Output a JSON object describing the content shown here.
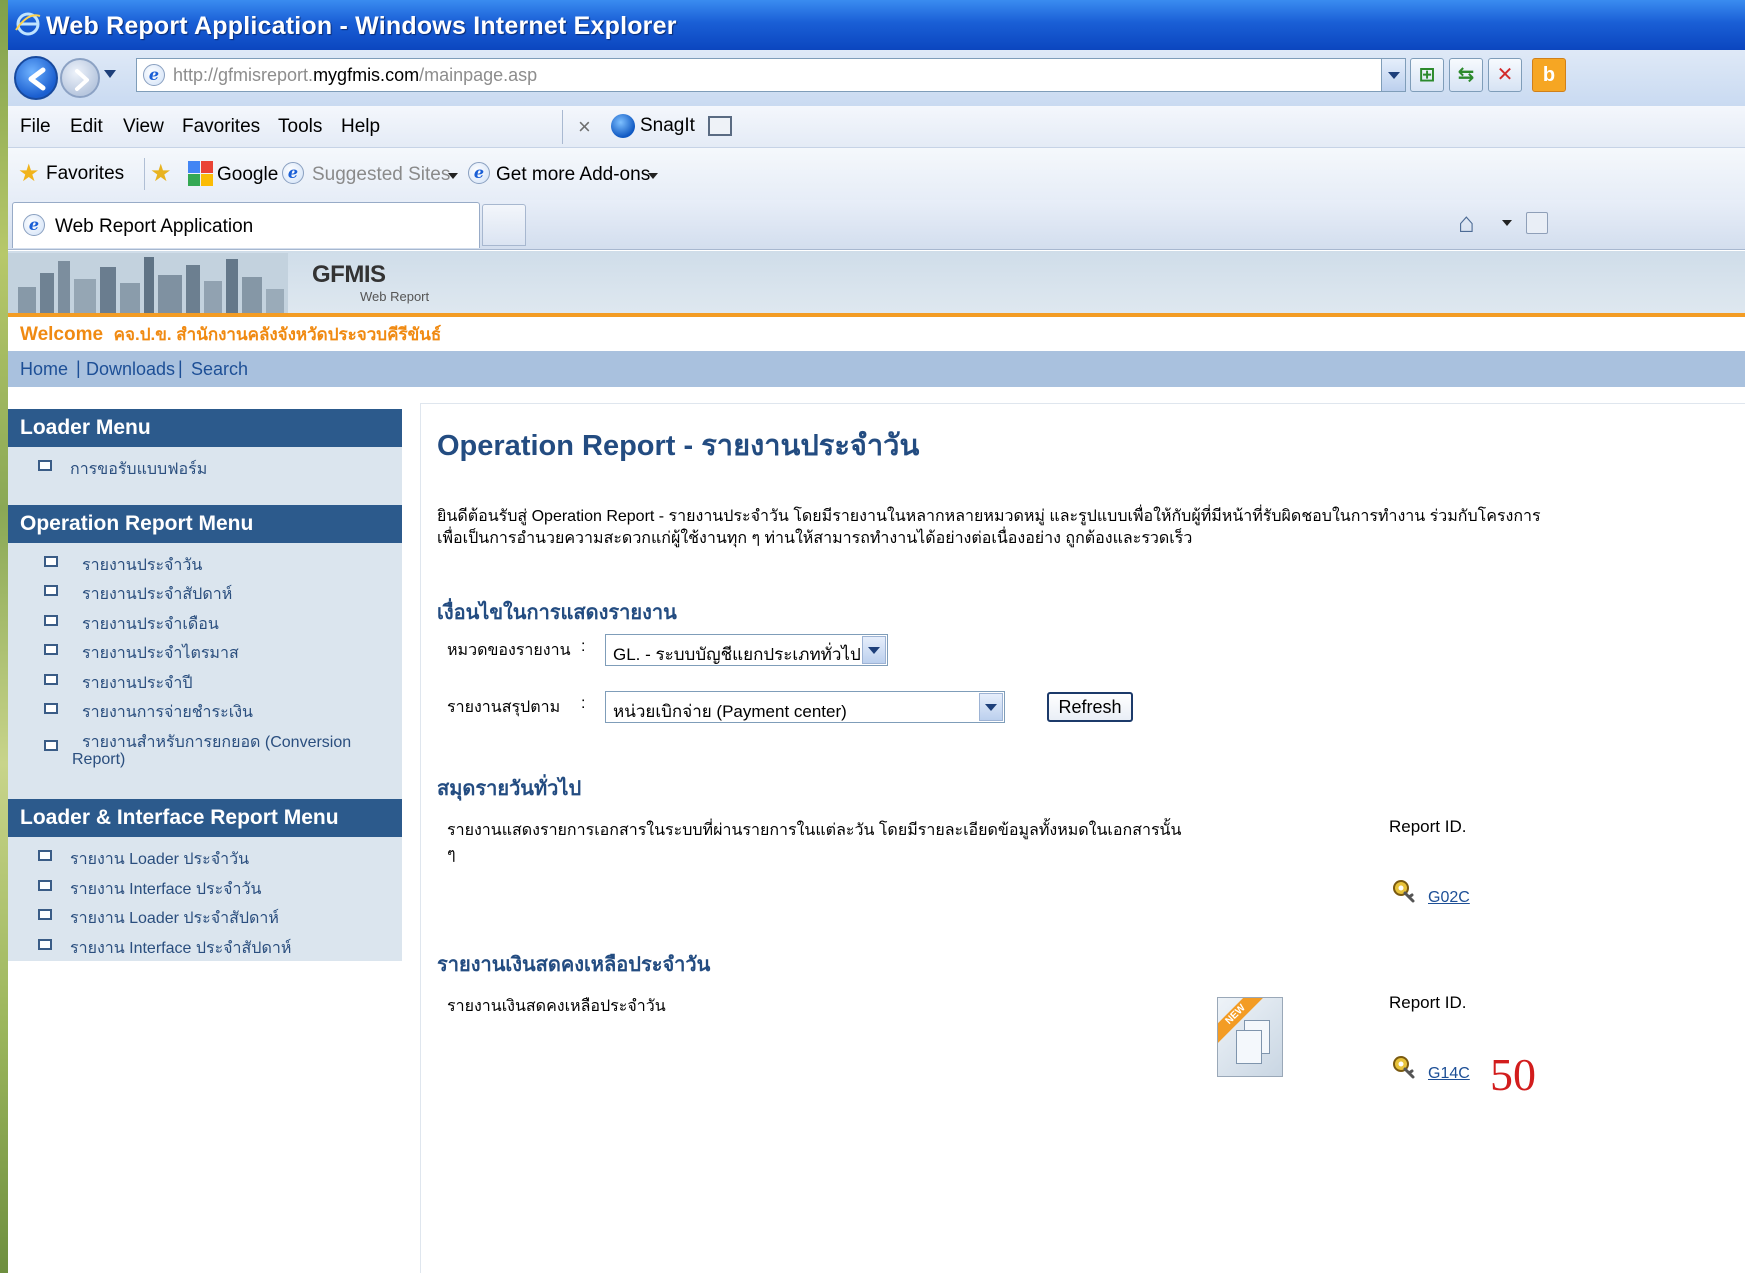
{
  "window": {
    "title": "Web Report Application - Windows Internet Explorer"
  },
  "address": {
    "url_prefix": "http://gfmisreport.",
    "url_domain": "mygfmis.com",
    "url_path": "/mainpage.asp"
  },
  "menu": {
    "items": [
      "File",
      "Edit",
      "View",
      "Favorites",
      "Tools",
      "Help"
    ],
    "snagit": "SnagIt"
  },
  "favorites_bar": {
    "favorites_label": "Favorites",
    "google_label": "Google",
    "suggested_label": "Suggested Sites",
    "addons_label": "Get more Add-ons"
  },
  "tabs": {
    "active_label": "Web Report Application"
  },
  "banner": {
    "brand": "GFMIS",
    "sub": "Web Report"
  },
  "welcome": {
    "label": "Welcome",
    "user": "คจ.ป.ข. สำนักงานคลังจังหวัดประจวบคีรีขันธ์"
  },
  "topnav": {
    "items": [
      "Home",
      "Downloads",
      "Search"
    ]
  },
  "sidebar": {
    "loader_menu": {
      "title": "Loader Menu",
      "items": [
        "การขอรับแบบฟอร์ม"
      ]
    },
    "operation_menu": {
      "title": "Operation Report Menu",
      "items": [
        "รายงานประจำวัน",
        "รายงานประจำสัปดาห์",
        "รายงานประจำเดือน",
        "รายงานประจำไตรมาส",
        "รายงานประจำปี",
        "รายงานการจ่ายชำระเงิน",
        "รายงานสำหรับการยกยอด (Conversion",
        "Report)"
      ]
    },
    "loader_interface_menu": {
      "title": "Loader & Interface Report Menu",
      "items": [
        "รายงาน Loader ประจำวัน",
        "รายงาน Interface ประจำวัน",
        "รายงาน Loader ประจำสัปดาห์",
        "รายงาน Interface ประจำสัปดาห์"
      ]
    }
  },
  "main": {
    "title": "Operation Report - รายงานประจำวัน",
    "intro_line1": "ยินดีต้อนรับสู่ Operation Report - รายงานประจำวัน  โดยมีรายงานในหลากหลายหมวดหมู่ และรูปแบบเพื่อให้กับผู้ที่มีหน้าที่รับผิดชอบในการทำงาน ร่วมกับโครงการ",
    "intro_line2": "เพื่อเป็นการอำนวยความสะดวกแก่ผู้ใช้งานทุก ๆ ท่านให้สามารถทำงานได้อย่างต่อเนื่องอย่าง ถูกต้องและรวดเร็ว",
    "conditions_title": "เงื่อนไขในการแสดงรายงาน",
    "category_label": "หมวดของรายงาน",
    "category_value": "GL. - ระบบบัญชีแยกประเภททั่วไป",
    "summary_label": "รายงานสรุปตาม",
    "summary_value": "หน่วยเบิกจ่าย (Payment center)",
    "colon": ":",
    "refresh_label": "Refresh",
    "section1": {
      "title": "สมุดรายวันทั่วไป",
      "desc_line1": "รายงานแสดงรายการเอกสารในระบบที่ผ่านรายการในแต่ละวัน โดยมีรายละเอียดข้อมูลทั้งหมดในเอกสารนั้น",
      "desc_line2": "ๆ",
      "report_id_label": "Report ID.",
      "report_id": "G02C"
    },
    "section2": {
      "title": "รายงานเงินสดคงเหลือประจำวัน",
      "desc": "รายงานเงินสดคงเหลือประจำวัน",
      "new_badge": "NEW",
      "report_id_label": "Report ID.",
      "report_id": "G14C"
    }
  },
  "slide_number": "50"
}
